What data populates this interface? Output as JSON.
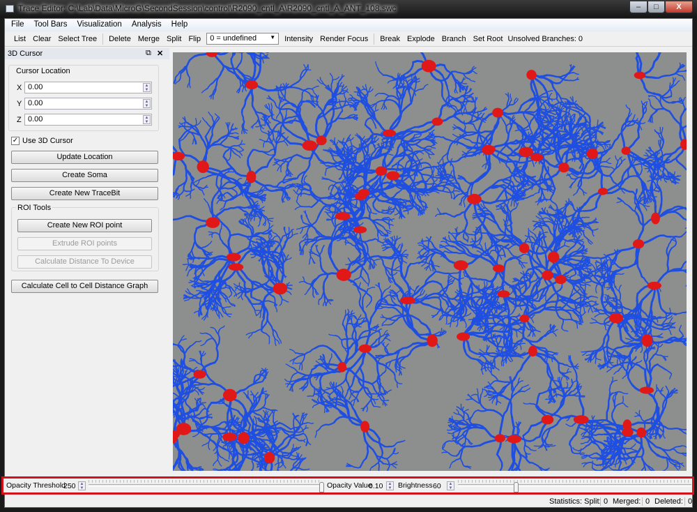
{
  "window": {
    "title": "Trace Editor: C:\\Lab\\Data\\MicroG\\SecondSession\\control\\R2090_cntl_A\\R2090_cntl_A_ANT_108.swc",
    "minimize": "–",
    "maximize": "□",
    "close": "X"
  },
  "menu": [
    "File",
    "Tool Bars",
    "Visualization",
    "Analysis",
    "Help"
  ],
  "toolbar": {
    "group1": [
      "List",
      "Clear",
      "Select Tree"
    ],
    "group2": [
      "Delete",
      "Merge",
      "Split",
      "Flip"
    ],
    "combo": "0 = undefined",
    "group3": [
      "Intensity",
      "Render Focus"
    ],
    "group4": [
      "Break",
      "Explode",
      "Branch",
      "Set Root"
    ],
    "unsolved": "Unsolved Branches: 0"
  },
  "dock": {
    "title": "3D Cursor",
    "cursor_group": "Cursor Location",
    "x_label": "X",
    "x": "0.00",
    "y_label": "Y",
    "y": "0.00",
    "z_label": "Z",
    "z": "0.00",
    "use_cursor": "Use 3D Cursor",
    "use_cursor_checked": true,
    "update": "Update Location",
    "soma": "Create Soma",
    "tracebit": "Create New TraceBit",
    "roi_group": "ROI Tools",
    "roi_point": "Create New ROI point",
    "extrude": "Extrude ROI points",
    "distance": "Calculate Distance To Device",
    "graph": "Calculate Cell to Cell Distance Graph"
  },
  "bottom": {
    "opacity_threshold_label": "Opacity Threshold",
    "opacity_threshold": "250",
    "opacity_threshold_slider_pct": 100,
    "opacity_value_label": "Opacity Value",
    "opacity_value": "0.10",
    "brightness_label": "Brightness",
    "brightness": "60",
    "brightness_slider_pct": 25
  },
  "status": {
    "statistics": "Statistics: Split:",
    "split": "0",
    "merged_label": "Merged:",
    "merged": "0",
    "deleted_label": "Deleted:",
    "deleted": "0"
  },
  "colors": {
    "trace": "#1f4fe0",
    "soma": "#e01818",
    "background": "#8d8f8e",
    "highlight": "#d0121a"
  }
}
